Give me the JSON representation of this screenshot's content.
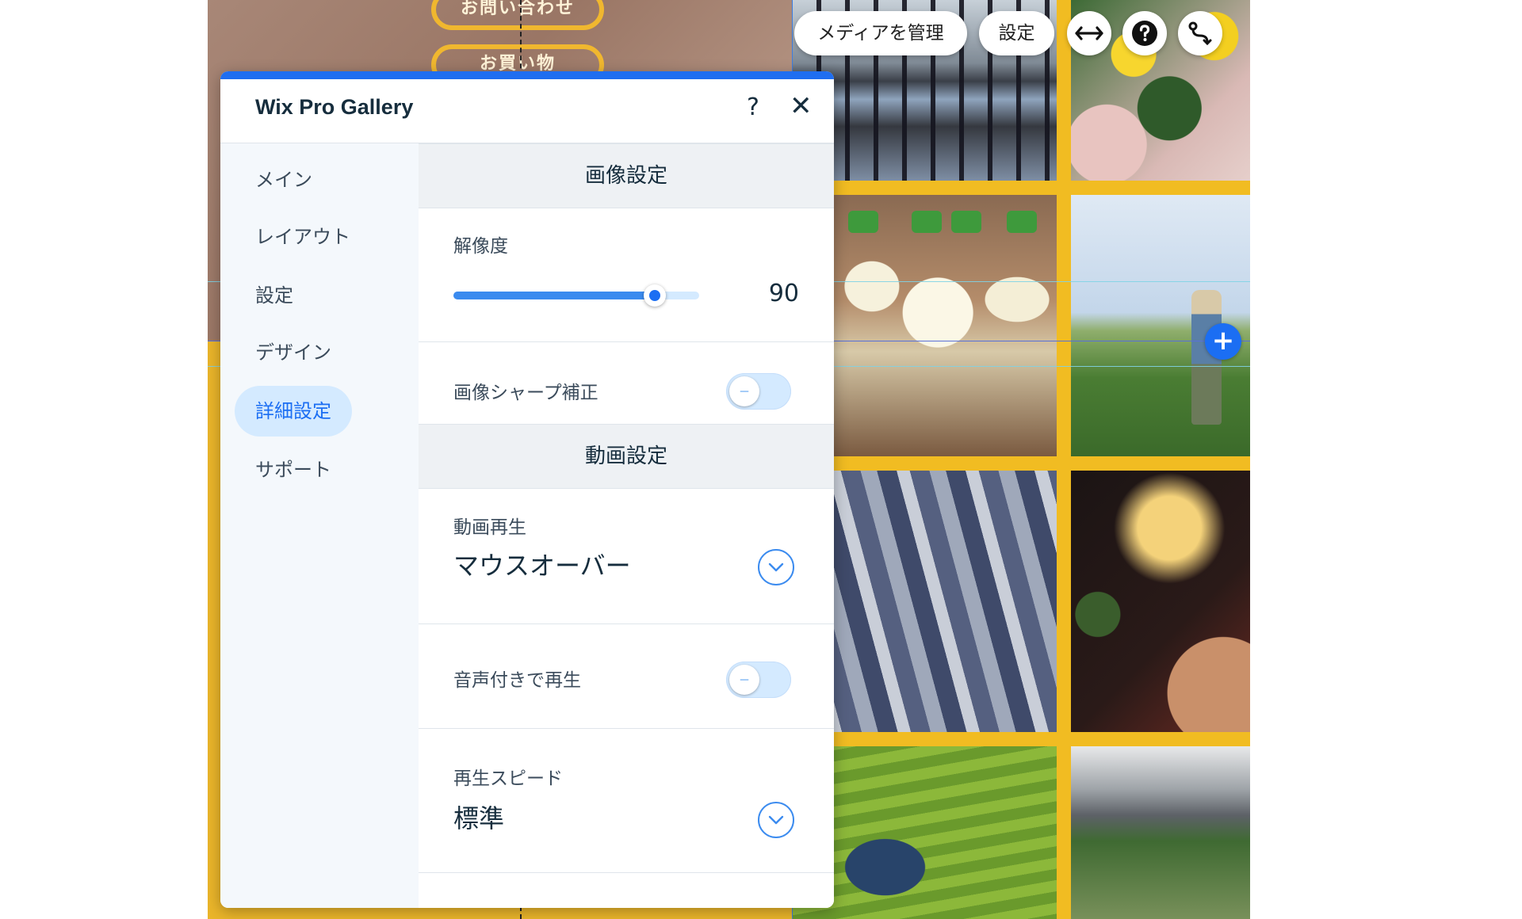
{
  "site": {
    "menu_contact": "お問い合わせ",
    "menu_shopping": "お買い物"
  },
  "toolbar": {
    "manage_media": "メディアを管理",
    "settings": "設定",
    "icons": [
      "stretch-icon",
      "help-icon",
      "connect-icon",
      "plus-icon"
    ]
  },
  "panel": {
    "title": "Wix Pro Gallery",
    "help": "?",
    "close": "✕",
    "sidebar": {
      "items": [
        {
          "label": "メイン"
        },
        {
          "label": "レイアウト"
        },
        {
          "label": "設定"
        },
        {
          "label": "デザイン"
        },
        {
          "label": "詳細設定",
          "active": true
        },
        {
          "label": "サポート"
        }
      ]
    },
    "image_settings": {
      "heading": "画像設定",
      "resolution_label": "解像度",
      "resolution_value": "90",
      "resolution_fraction": 0.82,
      "sharpen_label": "画像シャープ補正",
      "sharpen_on": false
    },
    "video_settings": {
      "heading": "動画設定",
      "playback_label": "動画再生",
      "playback_value": "マウスオーバー",
      "sound_label": "音声付きで再生",
      "sound_on": false,
      "speed_label": "再生スピード",
      "speed_value": "標準"
    }
  },
  "colors": {
    "accent": "#1b6ef3",
    "panel_topbar": "#1f6ef0",
    "site_yellow": "#eab52a",
    "active_nav_bg": "#d4eaff"
  }
}
